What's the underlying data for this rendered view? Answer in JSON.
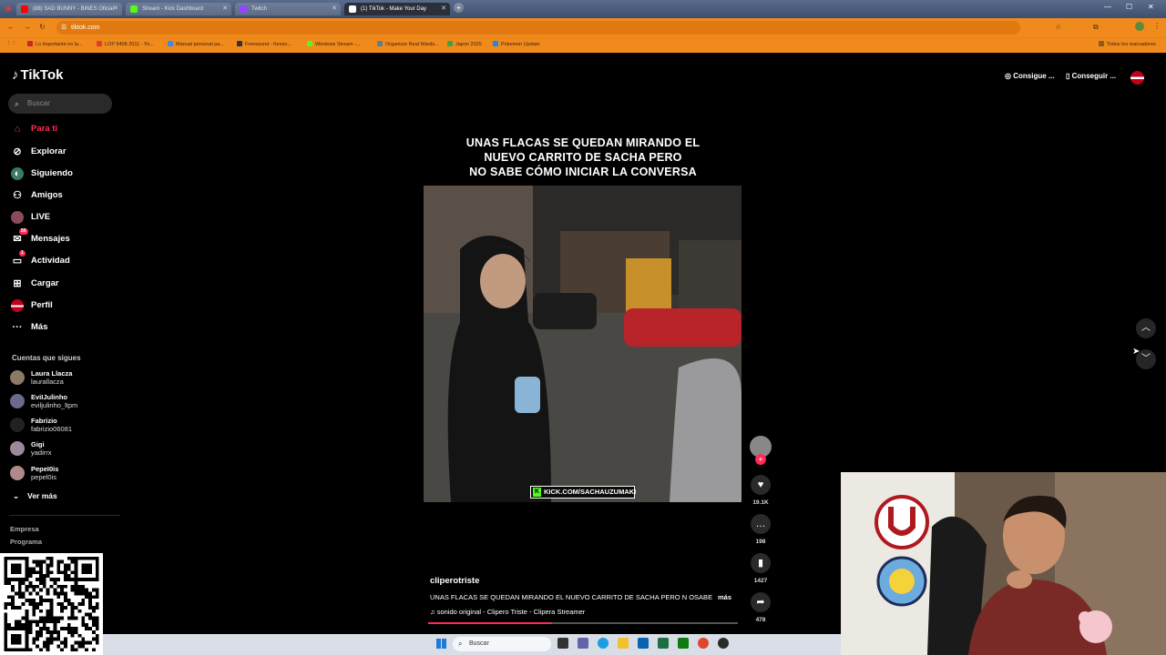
{
  "browser": {
    "tabs": [
      {
        "label": "(88) SAD BUNNY - BINES Oficial",
        "color": "#ff0000"
      },
      {
        "label": "Stream - Kick Dashboard",
        "color": "#53fc18"
      },
      {
        "label": "Twitch",
        "color": "#9146ff"
      },
      {
        "label": "(1) TikTok - Make Your Day",
        "color": "#111111"
      }
    ],
    "url": "tiktok.com",
    "bookmarks": [
      {
        "label": "Lo importante no la...",
        "color": "#c62828"
      },
      {
        "label": "LOP 9408 2011 - Yo...",
        "color": "#e53935"
      },
      {
        "label": "Manual personal pa...",
        "color": "#4285f4"
      },
      {
        "label": "Freesound - freeso...",
        "color": "#333333"
      },
      {
        "label": "Windows Stream -...",
        "color": "#53fc18"
      },
      {
        "label": "Organizar Real Wards...",
        "color": "#607d8b"
      },
      {
        "label": "Japon 2025",
        "color": "#43a047"
      },
      {
        "label": "Pokemon Update",
        "color": "#1e88e5"
      }
    ],
    "bookmarks_all": "Todos los marcadores"
  },
  "tiktok": {
    "logo": "TikTok",
    "search_placeholder": "Buscar",
    "nav": [
      {
        "label": "Para ti",
        "icon": "home-icon",
        "active": true
      },
      {
        "label": "Explorar",
        "icon": "compass-icon"
      },
      {
        "label": "Siguiendo",
        "icon": "following-icon"
      },
      {
        "label": "Amigos",
        "icon": "friends-icon"
      },
      {
        "label": "LIVE",
        "icon": "live-icon"
      },
      {
        "label": "Mensajes",
        "icon": "messages-icon",
        "badge": "50"
      },
      {
        "label": "Actividad",
        "icon": "activity-icon",
        "badge": "1"
      },
      {
        "label": "Cargar",
        "icon": "upload-icon"
      },
      {
        "label": "Perfil",
        "icon": "profile-icon"
      },
      {
        "label": "Más",
        "icon": "more-icon"
      }
    ],
    "following_title": "Cuentas que sigues",
    "following": [
      {
        "name": "Laura Llacza",
        "handle": "laurallacza"
      },
      {
        "name": "EviIJulinho",
        "handle": "eviljulinho_ltpm"
      },
      {
        "name": "Fabrizio",
        "handle": "fabrizio06081"
      },
      {
        "name": "Gigi",
        "handle": "yadirrx"
      },
      {
        "name": "PepeI0is",
        "handle": "pepel0is"
      }
    ],
    "see_more": "Ver más",
    "footer": [
      "Empresa",
      "Programa"
    ],
    "top_buttons": [
      "Consigue ...",
      "Conseguir ..."
    ]
  },
  "video": {
    "caption_lines": [
      "UNAS FLACAS SE QUEDAN MIRANDO EL",
      "NUEVO CARRITO DE SACHA PERO",
      "NO SABE CÓMO INICIAR LA CONVERSA"
    ],
    "watermark": "KICK.COM/SACHAUZUMAKI",
    "author": "cliperotriste",
    "description": "UNAS FLACAS SE QUEDAN MIRANDO EL NUEVO CARRITO DE SACHA PERO N OSABE",
    "more": "más",
    "music": "sonido original - Clipero Triste - Clipera Streamer",
    "progress": 0.4,
    "likes": "19.1K",
    "comments": "198",
    "saves": "1427",
    "shares": "478"
  },
  "taskbar": {
    "search_placeholder": "Buscar"
  }
}
